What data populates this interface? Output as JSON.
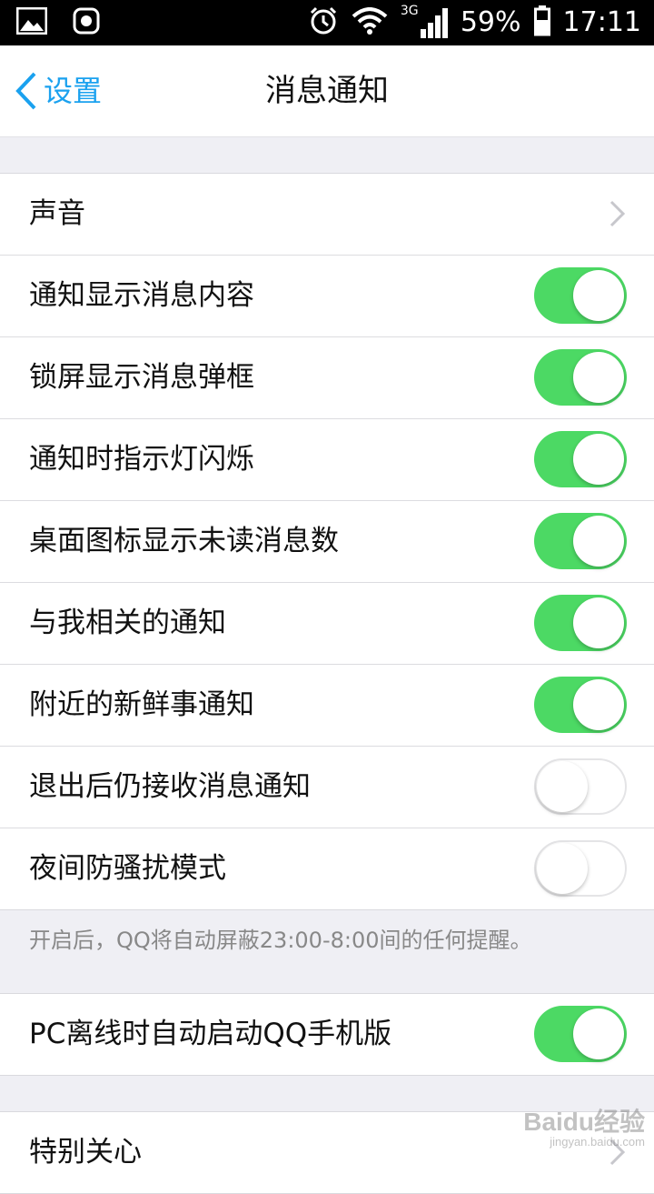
{
  "status_bar": {
    "network": "3G",
    "battery": "59%",
    "time": "17:11",
    "icons": [
      "gallery-icon",
      "huawei-icon",
      "alarm-icon",
      "wifi-icon",
      "signal-icon",
      "battery-icon"
    ]
  },
  "nav": {
    "back_label": "设置",
    "title": "消息通知"
  },
  "group1": {
    "rows": [
      {
        "label": "声音",
        "type": "link"
      },
      {
        "label": "通知显示消息内容",
        "type": "toggle",
        "on": true
      },
      {
        "label": "锁屏显示消息弹框",
        "type": "toggle",
        "on": true
      },
      {
        "label": "通知时指示灯闪烁",
        "type": "toggle",
        "on": true
      },
      {
        "label": "桌面图标显示未读消息数",
        "type": "toggle",
        "on": true
      },
      {
        "label": "与我相关的通知",
        "type": "toggle",
        "on": true
      },
      {
        "label": "附近的新鲜事通知",
        "type": "toggle",
        "on": true
      },
      {
        "label": "退出后仍接收消息通知",
        "type": "toggle",
        "on": false
      },
      {
        "label": "夜间防骚扰模式",
        "type": "toggle",
        "on": false
      }
    ]
  },
  "footnote": "开启后，QQ将自动屏蔽23:00-8:00间的任何提醒。",
  "group2": {
    "rows": [
      {
        "label": "PC离线时自动启动QQ手机版",
        "type": "toggle",
        "on": true
      }
    ]
  },
  "group3": {
    "rows": [
      {
        "label": "特别关心",
        "type": "link"
      }
    ]
  },
  "watermark": {
    "brand": "Baidu经验",
    "url": "jingyan.baidu.com"
  },
  "colors": {
    "accent": "#1aa1ef",
    "toggle_on": "#4cd964",
    "background": "#efeff4"
  }
}
